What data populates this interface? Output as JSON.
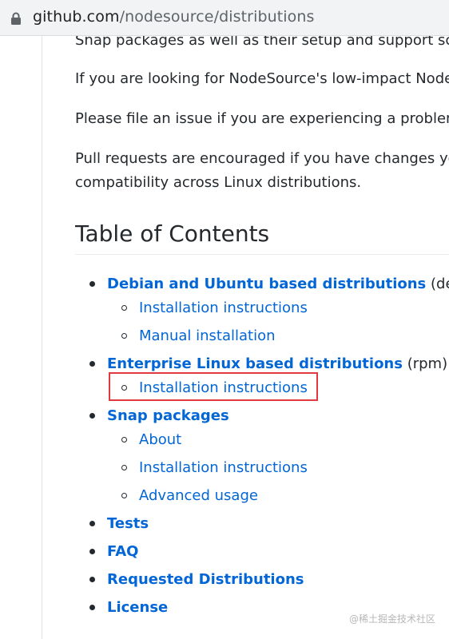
{
  "browser": {
    "url_host": "github.com",
    "url_path": "/nodesource/distributions"
  },
  "paragraphs": [
    "Snap packages as well as their setup and support scri",
    "If you are looking for NodeSource's low-impact Node",
    "Please file an issue if you are experiencing a problem",
    "Pull requests are encouraged if you have changes you",
    "compatibility across Linux distributions."
  ],
  "toc": {
    "heading": "Table of Contents",
    "sections": [
      {
        "label": "Debian and Ubuntu based distributions",
        "suffix": "(deb)",
        "children": [
          "Installation instructions",
          "Manual installation"
        ]
      },
      {
        "label": "Enterprise Linux based distributions",
        "suffix": "(rpm)",
        "children": [
          "Installation instructions"
        ]
      },
      {
        "label": "Snap packages",
        "suffix": "",
        "children": [
          "About",
          "Installation instructions",
          "Advanced usage"
        ]
      },
      {
        "label": "Tests",
        "suffix": "",
        "children": []
      },
      {
        "label": "FAQ",
        "suffix": "",
        "children": []
      },
      {
        "label": "Requested Distributions",
        "suffix": "",
        "children": []
      },
      {
        "label": "License",
        "suffix": "",
        "children": []
      }
    ]
  },
  "watermark": "@稀土掘金技术社区",
  "colors": {
    "link": "#0366d6",
    "text": "#24292e",
    "highlight_box": "#e0393e"
  }
}
